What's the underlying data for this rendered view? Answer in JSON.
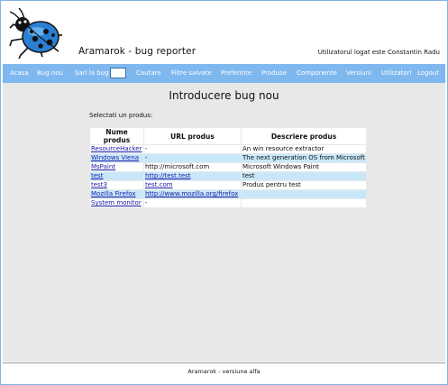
{
  "header": {
    "app_title": "Aramarok - bug reporter",
    "user_info": "Utilizatorul logat este Constantin Radu"
  },
  "nav": {
    "items": [
      "Acasa",
      "Bug nou"
    ],
    "goto_label": "Sari la bug",
    "goto_value": "",
    "items_right": [
      "Cautare",
      "Filtre salvate",
      "Preferinte",
      "Produse",
      "Componente",
      "Versiuni",
      "Utilizatori",
      "Logout"
    ]
  },
  "main": {
    "title": "Introducere bug nou",
    "prompt": "Selectati un produs:",
    "table": {
      "headers": [
        "Nume produs",
        "URL produs",
        "Descriere produs"
      ],
      "rows": [
        {
          "name": "ResourceHacker",
          "url": "-",
          "description": "An win resource extractor"
        },
        {
          "name": "Windows Viena",
          "url": "-",
          "description": "The next generation OS from Microsoft"
        },
        {
          "name": "MsPaint",
          "url": "http://microsoft.com",
          "description": "Microsoft Windows Paint"
        },
        {
          "name": "test",
          "url": "http://test.test",
          "description": "test"
        },
        {
          "name": "test3",
          "url": "test.com",
          "description": "Produs pentru test"
        },
        {
          "name": "Mozilla Firefox",
          "url": "http://www.mozilla.org/firefox",
          "description": ""
        },
        {
          "name": "System monitor",
          "url": "-",
          "description": ""
        }
      ]
    }
  },
  "footer": {
    "text": "Aramarok - versiune alfa"
  },
  "colors": {
    "navbar": "#7fb8ef",
    "row_highlight": "#c8e8f9",
    "content_bg": "#e8e8e8",
    "link": "#1a1aa6"
  }
}
